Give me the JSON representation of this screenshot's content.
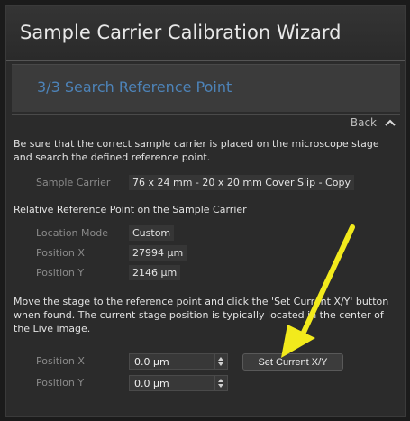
{
  "window": {
    "title": "Sample Carrier Calibration Wizard"
  },
  "step": {
    "title": "3/3  Search Reference Point"
  },
  "nav": {
    "back_label": "Back"
  },
  "intro_text": "Be sure that the correct sample carrier is placed on the microscope stage and search the defined reference point.",
  "sample_carrier": {
    "label": "Sample Carrier",
    "value": "76 x 24 mm - 20 x 20 mm Cover Slip - Copy"
  },
  "reference_section": {
    "heading": "Relative Reference Point on the Sample Carrier",
    "location_mode": {
      "label": "Location Mode",
      "value": "Custom"
    },
    "position_x": {
      "label": "Position X",
      "value": "27994 µm"
    },
    "position_y": {
      "label": "Position Y",
      "value": "2146 µm"
    }
  },
  "instructions_text": "Move the stage to the reference point and click the 'Set Current X/Y' button when found. The current stage position is typically located in the center of the Live image.",
  "stage": {
    "position_x": {
      "label": "Position X",
      "value": "0.0 µm"
    },
    "position_y": {
      "label": "Position Y",
      "value": "0.0 µm"
    },
    "set_button_label": "Set Current X/Y"
  },
  "colors": {
    "accent": "#4d83b8",
    "annotation_arrow": "#f2ea1c"
  },
  "icons": {
    "back": "chevron-up-icon",
    "spinner": "spinner-arrows-icon",
    "annotation": "annotation-arrow"
  }
}
